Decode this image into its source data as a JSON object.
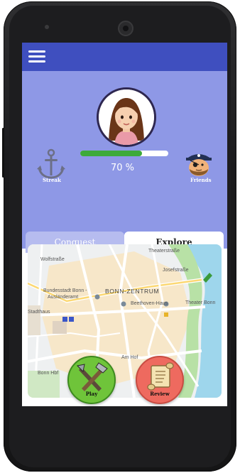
{
  "header": {
    "progress_percent": 70,
    "progress_label": "70 %"
  },
  "badges": {
    "streak_label": "Streak",
    "friends_label": "Friends"
  },
  "tabs": [
    {
      "label": "Conquest",
      "active": false
    },
    {
      "label": "Explore",
      "active": true
    }
  ],
  "map": {
    "labels": [
      "Wolfstraße",
      "Theaterstraße",
      "Josefstraße",
      "Bundesstadt Bonn -",
      "Ausländeramt",
      "BONN-ZENTRUM",
      "Beethoven-Haus",
      "Theater Bonn",
      "Stadthaus",
      "Bonn Hbf",
      "Am Hof"
    ]
  },
  "actions": {
    "play_label": "Play",
    "review_label": "Review"
  },
  "colors": {
    "appbar": "#3f4fbf",
    "header": "#8e98e6",
    "progress": "#3daa3a",
    "play": "#6fc43a",
    "review": "#ee6a5f"
  },
  "icons": {
    "menu": "menu-icon",
    "streak": "anchor-icon",
    "friends": "pirate-icon",
    "play": "tools-icon",
    "review": "scroll-icon"
  }
}
